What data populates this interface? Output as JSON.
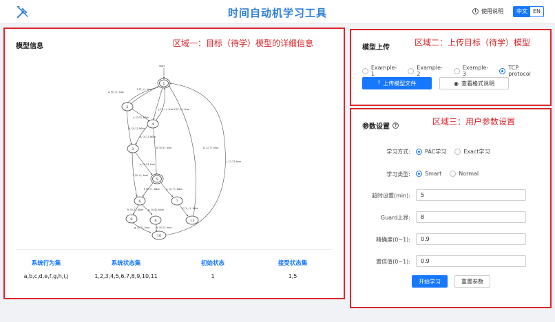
{
  "header": {
    "title": "时间自动机学习工具",
    "help": "使用说明",
    "lang_cn": "中文",
    "lang_en": "EN"
  },
  "panel1": {
    "title": "模型信息",
    "annotation": "区域一：目标（待学）模型的详细信息",
    "stats": [
      {
        "label": "系统行为集",
        "value": "a,b,c,d,e,f,g,h,i,j"
      },
      {
        "label": "系统状态集",
        "value": "1,2,3,4,5,6,7,8,9,10,11"
      },
      {
        "label": "初始状态",
        "value": "1"
      },
      {
        "label": "接受状态集",
        "value": "1,5"
      }
    ],
    "graph": {
      "start_label": "start",
      "nodes": [
        "1",
        "2",
        "3",
        "4",
        "5",
        "6",
        "7",
        "8",
        "9",
        "10",
        "11"
      ],
      "accepting": [
        "1",
        "5"
      ],
      "edge_labels": [
        "a, [0,+), true",
        "f, [1,+), true",
        "j, [0,+), true",
        "f, [1,+), true",
        "c, [0,1], false",
        "b, [0,2], false",
        "h, [0,2], false",
        "d, [0,5], true",
        "e, [0,3], true",
        "h, [2,7), true",
        "i, [2,2], true",
        "f, [0,+), true",
        "f, [0,+), false",
        "g, [0,+), false",
        "b, [0,3], false",
        "g, [0,4), false",
        "f, [0,+), false",
        "g, [0,7), true",
        "h, [0,7), true"
      ]
    }
  },
  "panel2": {
    "title": "模型上传",
    "annotation": "区域二：上传目标（待学）模型",
    "options": [
      "Example-1",
      "Example-2",
      "Example-3",
      "TCP protocol"
    ],
    "selected": "TCP protocol",
    "upload_button": "上传模型文件",
    "format_button": "查看格式说明"
  },
  "panel3": {
    "title": "参数设置",
    "annotation": "区域三：用户参数设置",
    "method_label": "学习方式:",
    "method_options": [
      "PAC学习",
      "Exact学习"
    ],
    "method_selected": "PAC学习",
    "type_label": "学习类型:",
    "type_options": [
      "Smart",
      "Normal"
    ],
    "type_selected": "Smart",
    "fields": [
      {
        "label": "超时设置(min):",
        "value": "5"
      },
      {
        "label": "Guard上界:",
        "value": "8"
      },
      {
        "label": "精确度(0~1):",
        "value": "0.9"
      },
      {
        "label": "置信值(0~1):",
        "value": "0.9"
      }
    ],
    "start_button": "开始学习",
    "reset_button": "重置参数"
  },
  "colors": {
    "brand": "#2e7fd8",
    "primary": "#1677ff",
    "annotation_red": "#d9262c"
  }
}
